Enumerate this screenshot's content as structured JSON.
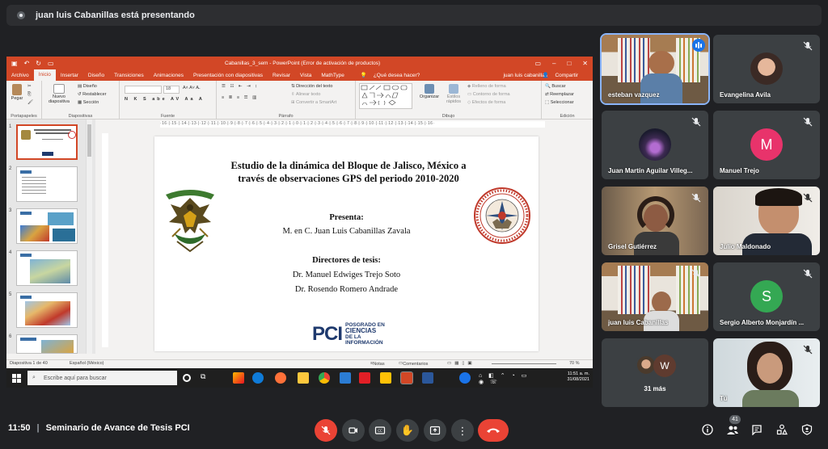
{
  "banner": {
    "text": "juan luis Cabanillas está presentando"
  },
  "ppt": {
    "window_title": "Cabanillas_3_sem - PowerPoint (Error de activación de productos)",
    "tabs": [
      "Archivo",
      "Inicio",
      "Insertar",
      "Diseño",
      "Transiciones",
      "Animaciones",
      "Presentación con diapositivas",
      "Revisar",
      "Vista",
      "MathType"
    ],
    "active_tab": "Inicio",
    "tell_me": "¿Qué desea hacer?",
    "user": "juan luis cabanillas",
    "share_label": "Compartir",
    "ribbon": {
      "paste": "Pegar",
      "new_slide": "Nuevo diapositiva",
      "layout": "Diseño",
      "reset": "Restablecer",
      "section": "Sección",
      "group_clipboard": "Portapapeles",
      "group_slides": "Diapositivas",
      "group_font": "Fuente",
      "group_paragraph": "Párrafo",
      "group_drawing": "Dibujo",
      "group_editing": "Edición",
      "font_size": "18",
      "text_direction": "Dirección del texto",
      "align_text": "Alinear texto",
      "smartart": "Convertir a SmartArt",
      "arrange": "Organizar",
      "quick_styles": "Estilos rápidos",
      "fill": "Relleno de forma",
      "outline": "Contorno de forma",
      "effects": "Efectos de forma",
      "find": "Buscar",
      "replace": "Reemplazar",
      "select": "Seleccionar"
    },
    "ruler": "·16·|·15·|·14·|·13·|·12·|·11·|·10·|·9·|·8·|·7·|·6·|·5·|·4·|·3·|·2·|·1·|·0·|·1·|·2·|·3·|·4·|·5·|·6·|·7·|·8·|·9·|·10·|·11·|·12·|·13·|·14·|·15·|·16·",
    "thumb_numbers": [
      "1",
      "2",
      "3",
      "4",
      "5",
      "6"
    ],
    "slide": {
      "title_line1": "Estudio de la dinámica del Bloque de Jalisco, México a",
      "title_line2": "través de observaciones GPS del periodo 2010-2020",
      "presenta_label": "Presenta:",
      "author": "M. en C. Juan Luis Cabanillas Zavala",
      "directors_label": "Directores de tesis:",
      "director1": "Dr. Manuel Edwiges Trejo Soto",
      "director2": "Dr. Rosendo Romero Andrade",
      "logo_big": "PCI",
      "logo_l1": "POSGRADO EN",
      "logo_l2": "CIENCIAS",
      "logo_l3": "DE LA",
      "logo_l4": "INFORMACIÓN"
    },
    "status": {
      "slide_count": "Diapositiva 1 de 40",
      "language": "Español (México)",
      "notes": "Notas",
      "comments": "Comentarios",
      "zoom": "70 %"
    },
    "taskbar": {
      "search_placeholder": "Escribe aquí para buscar",
      "time": "11:51 a. m.",
      "date": "31/08/2021"
    }
  },
  "participants": [
    {
      "name": "esteban vazquez",
      "type": "video",
      "speaking": true
    },
    {
      "name": "Evangelina Avila",
      "type": "photo",
      "muted": true
    },
    {
      "name": "Juan Martín Aguilar Villeg...",
      "type": "photo",
      "muted": true
    },
    {
      "name": "Manuel Trejo",
      "type": "avatar",
      "initial": "M",
      "color": "#e8336b",
      "muted": true
    },
    {
      "name": "Grisel Gutiérrez",
      "type": "video",
      "muted": true
    },
    {
      "name": "Julio Maldonado",
      "type": "video",
      "muted": true
    },
    {
      "name": "juan luis Cabanillas",
      "type": "video",
      "muted": true
    },
    {
      "name": "Sergio Alberto Monjardín ...",
      "type": "avatar",
      "initial": "S",
      "color": "#34a853",
      "muted": true
    },
    {
      "name": "31 más",
      "type": "more",
      "initial": "W"
    },
    {
      "name": "Tú",
      "type": "video",
      "muted": true
    }
  ],
  "bottom": {
    "time": "11:50",
    "meeting_name": "Seminario de Avance de Tesis PCI",
    "people_count": "41"
  }
}
